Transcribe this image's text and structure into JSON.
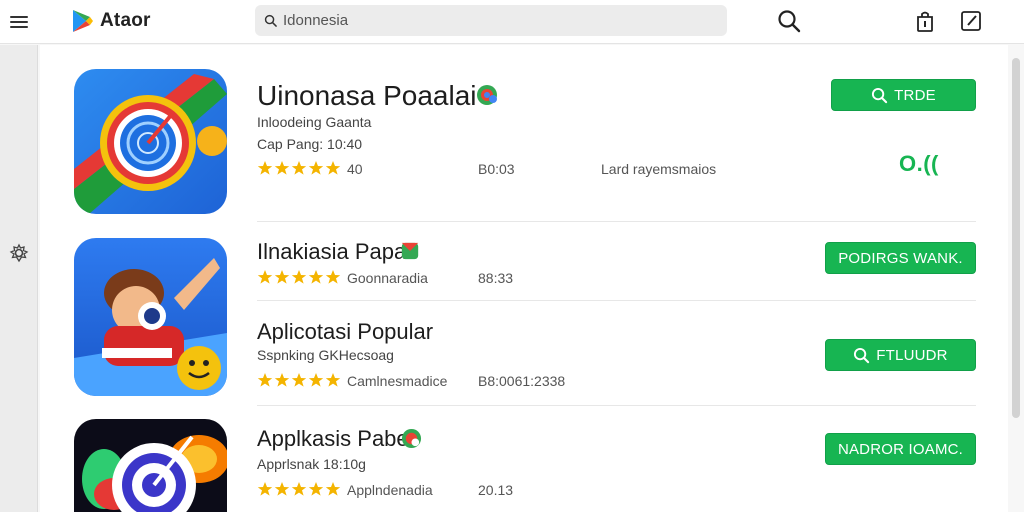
{
  "header": {
    "brand": "Ataor",
    "search": {
      "value": "Idonnesia",
      "placeholder": "Idonnesia"
    }
  },
  "apps": [
    {
      "title": "Uinonasa Poaalai",
      "subtitle1": "Inloodeing Gaanta",
      "subtitle2": "Cap Pang: 10:40",
      "rating_text": "40",
      "size": "B0:03",
      "category": "Lard rayemsmaios",
      "button_label": "TRDE",
      "rating_badge": "O.((",
      "stars": 5
    },
    {
      "title": "Ilnakiasia Papar",
      "rating_text": "Goonnaradia",
      "size": "88:33",
      "button_label": "PODIRGS WANK.",
      "stars": 5
    },
    {
      "title": "Aplicotasi Popular",
      "subtitle1": "Sspnking GKHecsoag",
      "rating_text": "Camlnesmadice",
      "size": "B8:0061:2338",
      "button_label": "FTLUUDR",
      "stars": 5
    },
    {
      "title": "Applkasis Paber",
      "subtitle1": "Apprlsnak 18:10g",
      "rating_text": "Applndenadia",
      "size": "20.13",
      "button_label": "NADROR IOAMC.",
      "stars": 5
    }
  ],
  "colors": {
    "accent": "#17b552",
    "star": "#f4b400"
  }
}
